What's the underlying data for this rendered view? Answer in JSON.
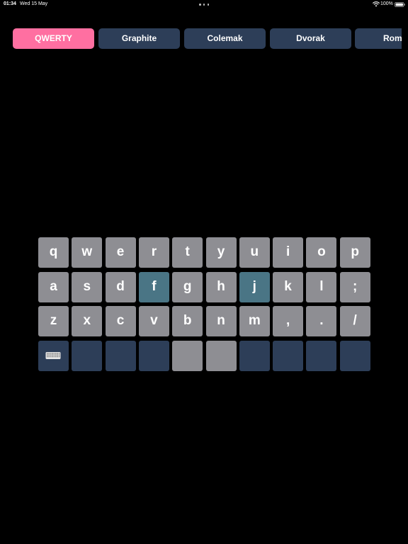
{
  "status_bar": {
    "time": "01:34",
    "date": "Wed 15 May",
    "battery": "100%"
  },
  "tabs": [
    {
      "label": "QWERTY",
      "active": true
    },
    {
      "label": "Graphite",
      "active": false
    },
    {
      "label": "Colemak",
      "active": false
    },
    {
      "label": "Dvorak",
      "active": false
    },
    {
      "label": "Roma",
      "active": false
    }
  ],
  "keyboard": {
    "rows": [
      [
        "q",
        "w",
        "e",
        "r",
        "t",
        "y",
        "u",
        "i",
        "o",
        "p"
      ],
      [
        "a",
        "s",
        "d",
        "f",
        "g",
        "h",
        "j",
        "k",
        "l",
        ";"
      ],
      [
        "z",
        "x",
        "c",
        "v",
        "b",
        "n",
        "m",
        ",",
        ".",
        "/"
      ]
    ],
    "highlighted_keys": [
      "f",
      "j"
    ],
    "bottom_row": [
      {
        "type": "keyboard-icon"
      },
      {
        "type": "blank-dark"
      },
      {
        "type": "blank-dark"
      },
      {
        "type": "blank-dark"
      },
      {
        "type": "blank-gray"
      },
      {
        "type": "blank-gray"
      },
      {
        "type": "blank-dark"
      },
      {
        "type": "blank-dark"
      },
      {
        "type": "blank-dark"
      },
      {
        "type": "blank-dark"
      }
    ]
  },
  "colors": {
    "background": "#000000",
    "key": "#8e8e93",
    "key_highlight": "#4a7585",
    "key_dark": "#2d3e58",
    "tab": "#2d3e58",
    "tab_active": "#ff6fa1"
  }
}
